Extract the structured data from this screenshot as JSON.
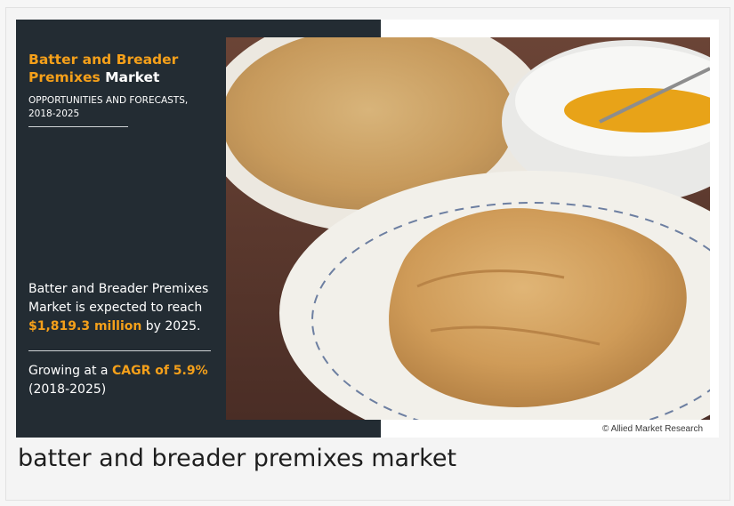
{
  "infographic": {
    "title_part1": "Batter and Breader",
    "title_part2": "Premixes",
    "title_part3": "Market",
    "subtitle_line1": "OPPORTUNITIES AND FORECASTS,",
    "subtitle_line2": "2018-2025",
    "stat_line1": "Batter and Breader Premixes",
    "stat_line2": "Market is expected to reach",
    "stat_value": "$1,819.3 million",
    "stat_suffix": "by 2025.",
    "growth_prefix": "Growing at a",
    "growth_value": "CAGR of 5.9%",
    "growth_period": "(2018-2025)",
    "credit": "© Allied Market Research"
  },
  "caption": "batter and breader premixes market",
  "colors": {
    "panel": "#232c33",
    "accent": "#f5a01a"
  }
}
